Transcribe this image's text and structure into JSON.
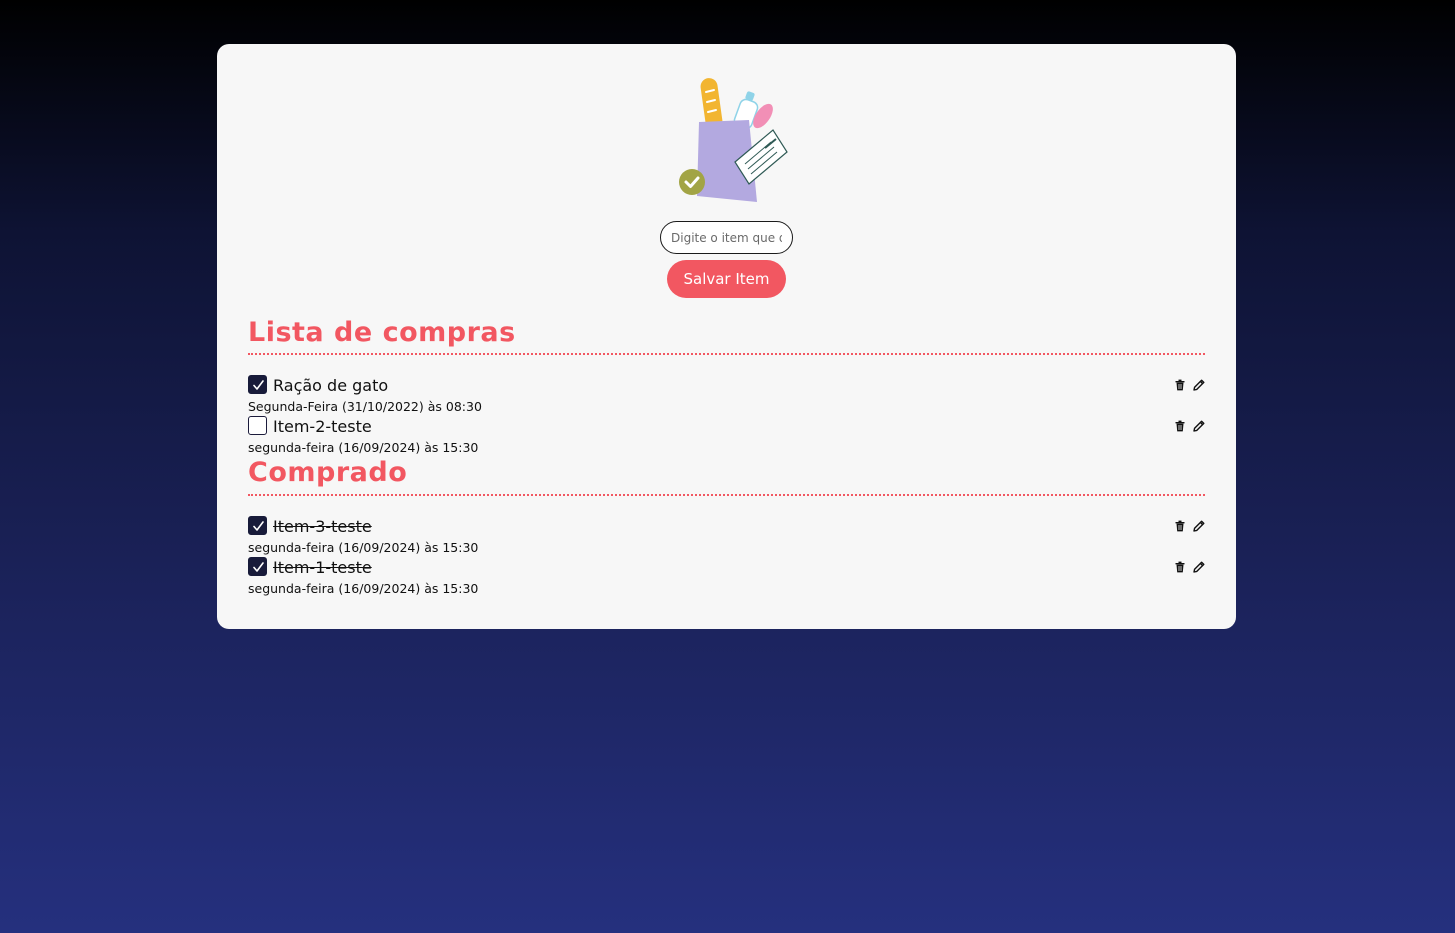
{
  "input": {
    "placeholder": "Digite o item que deseja adicionar"
  },
  "buttons": {
    "save_label": "Salvar Item"
  },
  "sections": {
    "shopping": {
      "title": "Lista de compras",
      "items": [
        {
          "name": "Ração de gato",
          "date": "Segunda-Feira (31/10/2022) às 08:30",
          "checked": true
        },
        {
          "name": "Item-2-teste",
          "date": "segunda-feira (16/09/2024) às 15:30",
          "checked": false
        }
      ]
    },
    "bought": {
      "title": "Comprado",
      "items": [
        {
          "name": "Item-3-teste",
          "date": "segunda-feira (16/09/2024) às 15:30",
          "checked": true
        },
        {
          "name": "Item-1-teste",
          "date": "segunda-feira (16/09/2024) às 15:30",
          "checked": true
        }
      ]
    }
  },
  "colors": {
    "accent": "#f25761",
    "checkbox_checked": "#181b3a",
    "card_background": "#f7f7f7"
  },
  "icons": {
    "logo": "grocery-bag-icon",
    "delete": "trash-icon",
    "edit": "pencil-icon",
    "check": "check-icon"
  }
}
